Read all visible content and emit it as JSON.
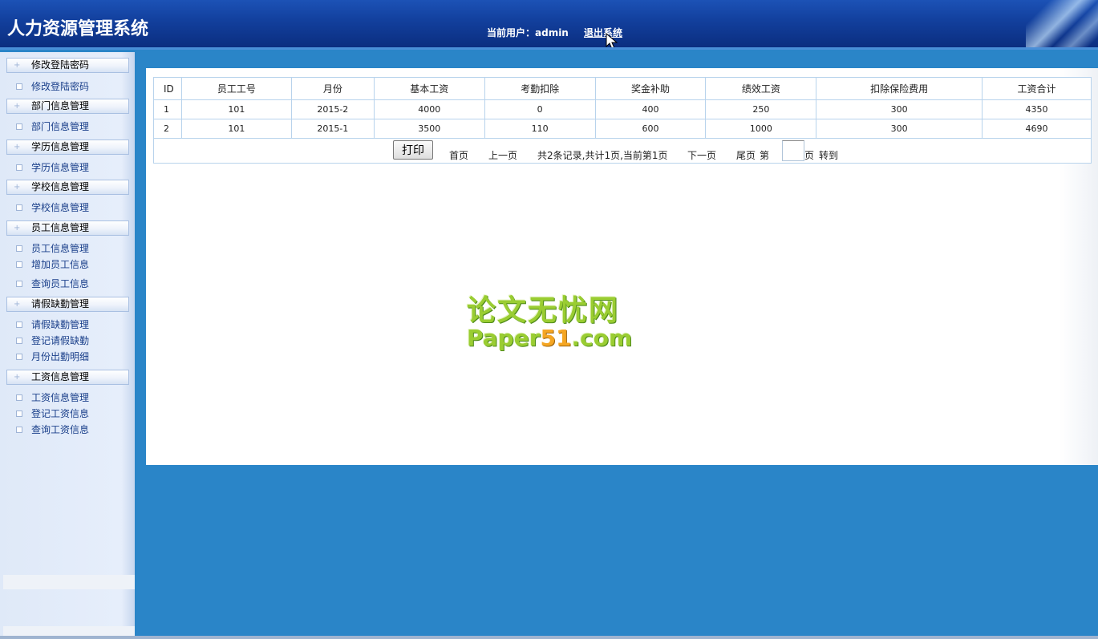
{
  "header": {
    "title": "人力资源管理系统",
    "current_user_label": "当前用户：admin",
    "logout_label": "退出系统"
  },
  "sidebar": {
    "groups": [
      {
        "title": "修改登陆密码",
        "items": [
          "修改登陆密码"
        ]
      },
      {
        "title": "部门信息管理",
        "items": [
          "部门信息管理"
        ]
      },
      {
        "title": "学历信息管理",
        "items": [
          "学历信息管理"
        ]
      },
      {
        "title": "学校信息管理",
        "items": [
          "学校信息管理"
        ]
      },
      {
        "title": "员工信息管理",
        "items": [
          "员工信息管理",
          "增加员工信息",
          "查询员工信息"
        ]
      },
      {
        "title": "请假缺勤管理",
        "items": [
          "请假缺勤管理",
          "登记请假缺勤",
          "月份出勤明细"
        ]
      },
      {
        "title": "工资信息管理",
        "items": [
          "工资信息管理",
          "登记工资信息",
          "查询工资信息"
        ]
      }
    ]
  },
  "table": {
    "headers": [
      "ID",
      "员工工号",
      "月份",
      "基本工资",
      "考勤扣除",
      "奖金补助",
      "绩效工资",
      "扣除保险费用",
      "工资合计"
    ],
    "rows": [
      [
        "1",
        "101",
        "2015-2",
        "4000",
        "0",
        "400",
        "250",
        "300",
        "4350"
      ],
      [
        "2",
        "101",
        "2015-1",
        "3500",
        "110",
        "600",
        "1000",
        "300",
        "4690"
      ]
    ]
  },
  "pager": {
    "print_label": "打印",
    "first": "首页",
    "prev": "上一页",
    "summary": "共2条记录,共计1页,当前第1页",
    "next": "下一页",
    "last": "尾页",
    "page_prefix": "第",
    "page_suffix": "页",
    "goto": "转到",
    "page_value": ""
  },
  "watermark": {
    "line1": "论文无忧网",
    "line2_a": "Paper",
    "line2_num": "51",
    "line2_b": ".com"
  },
  "colors": {
    "header_blue": "#123f9c",
    "main_blue": "#2a85c8",
    "sidebar_bg": "#e6eefb",
    "table_border": "#b8d3ec"
  }
}
